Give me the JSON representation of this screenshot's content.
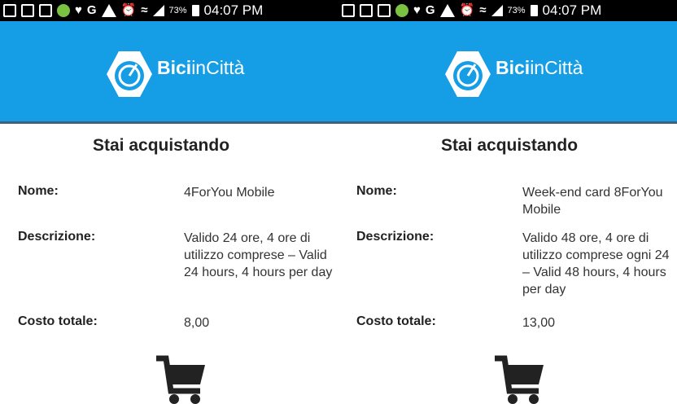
{
  "statusbar": {
    "battery": "73%",
    "time": "04:07 PM",
    "icons": [
      "message-icon",
      "screenshot-icon",
      "gallery-icon",
      "pokeball-icon",
      "twitter-icon",
      "google-icon",
      "warning-icon",
      "alarm-icon",
      "wifi-icon",
      "signal-icon",
      "battery-icon"
    ]
  },
  "app": {
    "brand_bold": "Bici",
    "brand_rest": "inCittà",
    "header_color": "#159de6"
  },
  "labels": {
    "title": "Stai acquistando",
    "name": "Nome:",
    "description": "Descrizione:",
    "total": "Costo totale:"
  },
  "screens": [
    {
      "name": "4ForYou Mobile",
      "description": "Valido 24 ore, 4 ore di utilizzo comprese – Valid 24 hours, 4 hours per day",
      "total": "8,00"
    },
    {
      "name": "Week-end card 8ForYou Mobile",
      "description": "Valido 48 ore, 4 ore di utilizzo comprese ogni 24 – Valid 48 hours, 4 hours per day",
      "total": "13,00"
    }
  ]
}
